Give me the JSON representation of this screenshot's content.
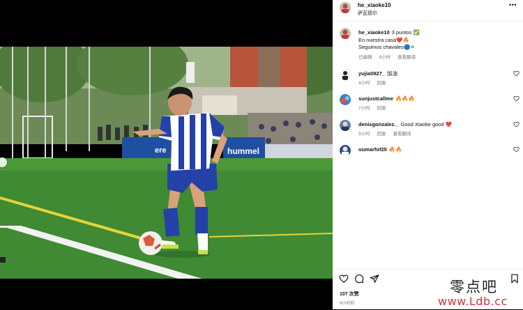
{
  "post": {
    "username": "he_xiaoke10",
    "location": "萨瓦德尔",
    "more_icon": "more-horizontal-icon"
  },
  "caption": {
    "username": "he_xiaoke10",
    "text_line1": "3 puntos ✅",
    "text_line2": "En nuestra casa❤️🔥",
    "text_line3": "Seguimos chavales🔵⚪",
    "edited": "已编辑",
    "time": "9小时",
    "translate": "查看翻译"
  },
  "comments": [
    {
      "username": "yujia0927_",
      "text": "加油",
      "time": "4小时",
      "reply": "回复",
      "translate": ""
    },
    {
      "username": "sunjustcallme",
      "text": "🔥🔥🔥",
      "time": "7小时",
      "reply": "回复",
      "translate": ""
    },
    {
      "username": "denisgonzalez._",
      "text": "Good Xiaoke good ❤️",
      "time": "9小时",
      "reply": "回复",
      "translate": "查看翻译"
    },
    {
      "username": "oumarfof25",
      "text": "🔥🔥",
      "time": "9小时",
      "reply": "回复",
      "translate": ""
    }
  ],
  "footer": {
    "likes": "107 次赞",
    "time": "9小时前"
  },
  "photo": {
    "banner_text": "hummel",
    "banner_text_2": "ere"
  },
  "watermark": {
    "line1": "零点吧",
    "line2": "www.Ldb.cc"
  },
  "colors": {
    "heart": "#ed4956",
    "pitch": "#3f8a33",
    "kit_blue": "#2441a8"
  }
}
